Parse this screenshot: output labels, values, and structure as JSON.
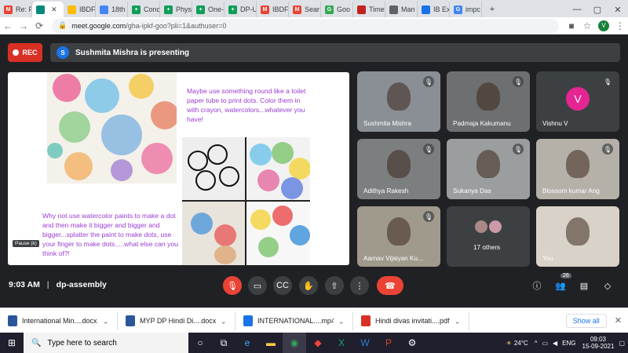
{
  "browser": {
    "tabs": [
      {
        "label": "Re: F",
        "icon": "gmail-icon",
        "color": "#ea4335",
        "letter": "M"
      },
      {
        "label": "",
        "icon": "meet-icon",
        "color": "#00897b",
        "letter": ""
      },
      {
        "label": "IBDF",
        "icon": "drive-icon",
        "color": "#fbbc04",
        "letter": ""
      },
      {
        "label": "18th",
        "icon": "doc-icon",
        "color": "#4285f4",
        "letter": ""
      },
      {
        "label": "Conc",
        "icon": "sheet-icon",
        "color": "#0f9d58",
        "letter": "+"
      },
      {
        "label": "Phys",
        "icon": "sheet-icon",
        "color": "#0f9d58",
        "letter": "+"
      },
      {
        "label": "One-",
        "icon": "sheet-icon",
        "color": "#0f9d58",
        "letter": "+"
      },
      {
        "label": "DP-U",
        "icon": "sheet-icon",
        "color": "#0f9d58",
        "letter": "+"
      },
      {
        "label": "IBDF",
        "icon": "gmail-icon",
        "color": "#ea4335",
        "letter": "M"
      },
      {
        "label": "Sear",
        "icon": "gmail-icon",
        "color": "#ea4335",
        "letter": "M"
      },
      {
        "label": "Goo",
        "icon": "google-icon",
        "color": "#34a853",
        "letter": "G"
      },
      {
        "label": "Time",
        "icon": "timer-icon",
        "color": "#c5221f",
        "letter": ""
      },
      {
        "label": "Man",
        "icon": "man-icon",
        "color": "#5f6368",
        "letter": ""
      },
      {
        "label": "IB Ex",
        "icon": "globe-icon",
        "color": "#1a73e8",
        "letter": ""
      },
      {
        "label": "impc",
        "icon": "google-icon",
        "color": "#4285f4",
        "letter": "G"
      }
    ],
    "url_host": "meet.google.com",
    "url_path": "/gha-ipkf-goo?pli=1&authuser=0",
    "profile_letter": "V"
  },
  "meet": {
    "rec_label": "REC",
    "presenter_initial": "S",
    "presenting_text": "Sushmita Mishra is presenting",
    "slide": {
      "top_text": "Maybe use something round like a toilet paper tube to print dots. Color them in with crayon, watercolors...whatever you have!",
      "bottom_text": "Why not use watercolor paints to make a dot and then make it bigger and bigger and bigger...splatter the paint to make dots, use your finger to make dots.....what else can you think of?!",
      "pause_label": "Pause (k)"
    },
    "participants": [
      {
        "name": "Sushmita Mishra",
        "bg": "#8a8f95"
      },
      {
        "name": "Padmaja Kakumanu",
        "bg": "#6d6f70"
      },
      {
        "name": "Vishnu V",
        "bg": "#3c4043",
        "initial": "V",
        "avatar_color": "#e52592"
      },
      {
        "name": "Adithya Rakesh",
        "bg": "#7c7f80"
      },
      {
        "name": "Sukanya Das",
        "bg": "#9a9e9e"
      },
      {
        "name": "Blossom kumar Ang",
        "bg": "#b5b0a8"
      },
      {
        "name": "Aarnav Vijaiyan Ku...",
        "bg": "#a09a8c"
      },
      {
        "name": "17 others",
        "bg": "#3c4043"
      },
      {
        "name": "You",
        "bg": "#d8d2c8"
      }
    ],
    "time": "9:03 AM",
    "meeting_code": "dp-assembly",
    "people_count": "26"
  },
  "downloads": {
    "items": [
      {
        "name": "International Min....docx",
        "icon": "word-icon",
        "color": "#2b579a"
      },
      {
        "name": "MYP DP Hindi Di....docx",
        "icon": "word-icon",
        "color": "#2b579a"
      },
      {
        "name": "INTERNATIONAL....mp4",
        "icon": "video-icon",
        "color": "#1a73e8"
      },
      {
        "name": "Hindi divas invitati....pdf",
        "icon": "pdf-icon",
        "color": "#d93025"
      }
    ],
    "show_all": "Show all"
  },
  "taskbar": {
    "search_placeholder": "Type here to search",
    "temperature": "24°C",
    "language": "ENG",
    "clock_time": "09:03",
    "clock_date": "15-09-2021"
  }
}
